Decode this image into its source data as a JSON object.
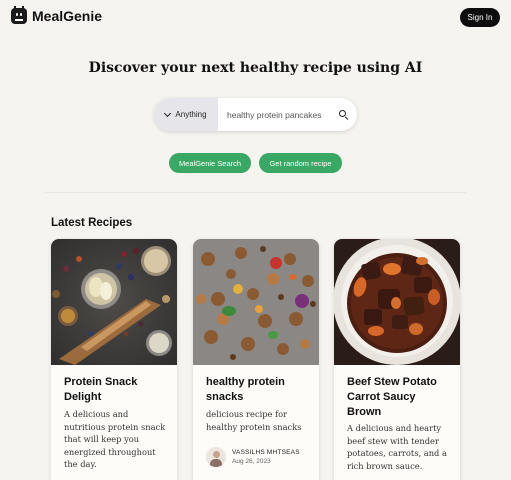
{
  "header": {
    "brand": "MealGenie",
    "signin_label": "Sign In"
  },
  "hero": {
    "headline_pre": "Discover your next ",
    "headline_bold": "healthy",
    "headline_post": " recipe using AI"
  },
  "search": {
    "filter_label": "Anything",
    "query_value": "healthy protein pancakes",
    "placeholder": ""
  },
  "actions": {
    "ai_search_label": "MealGenie Search",
    "random_label": "Get random recipe"
  },
  "recipes": {
    "section_title": "Latest Recipes",
    "items": [
      {
        "title": "Protein Snack Delight",
        "description": "A delicious and nutritious protein snack that will keep you energized throughout the day.",
        "image_icon": "food-flatlay-image"
      },
      {
        "title": "healthy protein snacks",
        "description": "delicious recipe for healthy protein snacks",
        "author": "VASSILHS MHTSEAS",
        "date": "Aug 26, 2023",
        "image_icon": "protein-snacks-image"
      },
      {
        "title": "Beef Stew Potato Carrot Saucy Brown",
        "description": "A delicious and hearty beef stew with tender potatoes, carrots, and a rich brown sauce.",
        "image_icon": "beef-stew-image"
      }
    ]
  },
  "colors": {
    "accent_green": "#3aa865",
    "signin_bg": "#0d0d0d",
    "page_bg": "#f5f4f0"
  }
}
